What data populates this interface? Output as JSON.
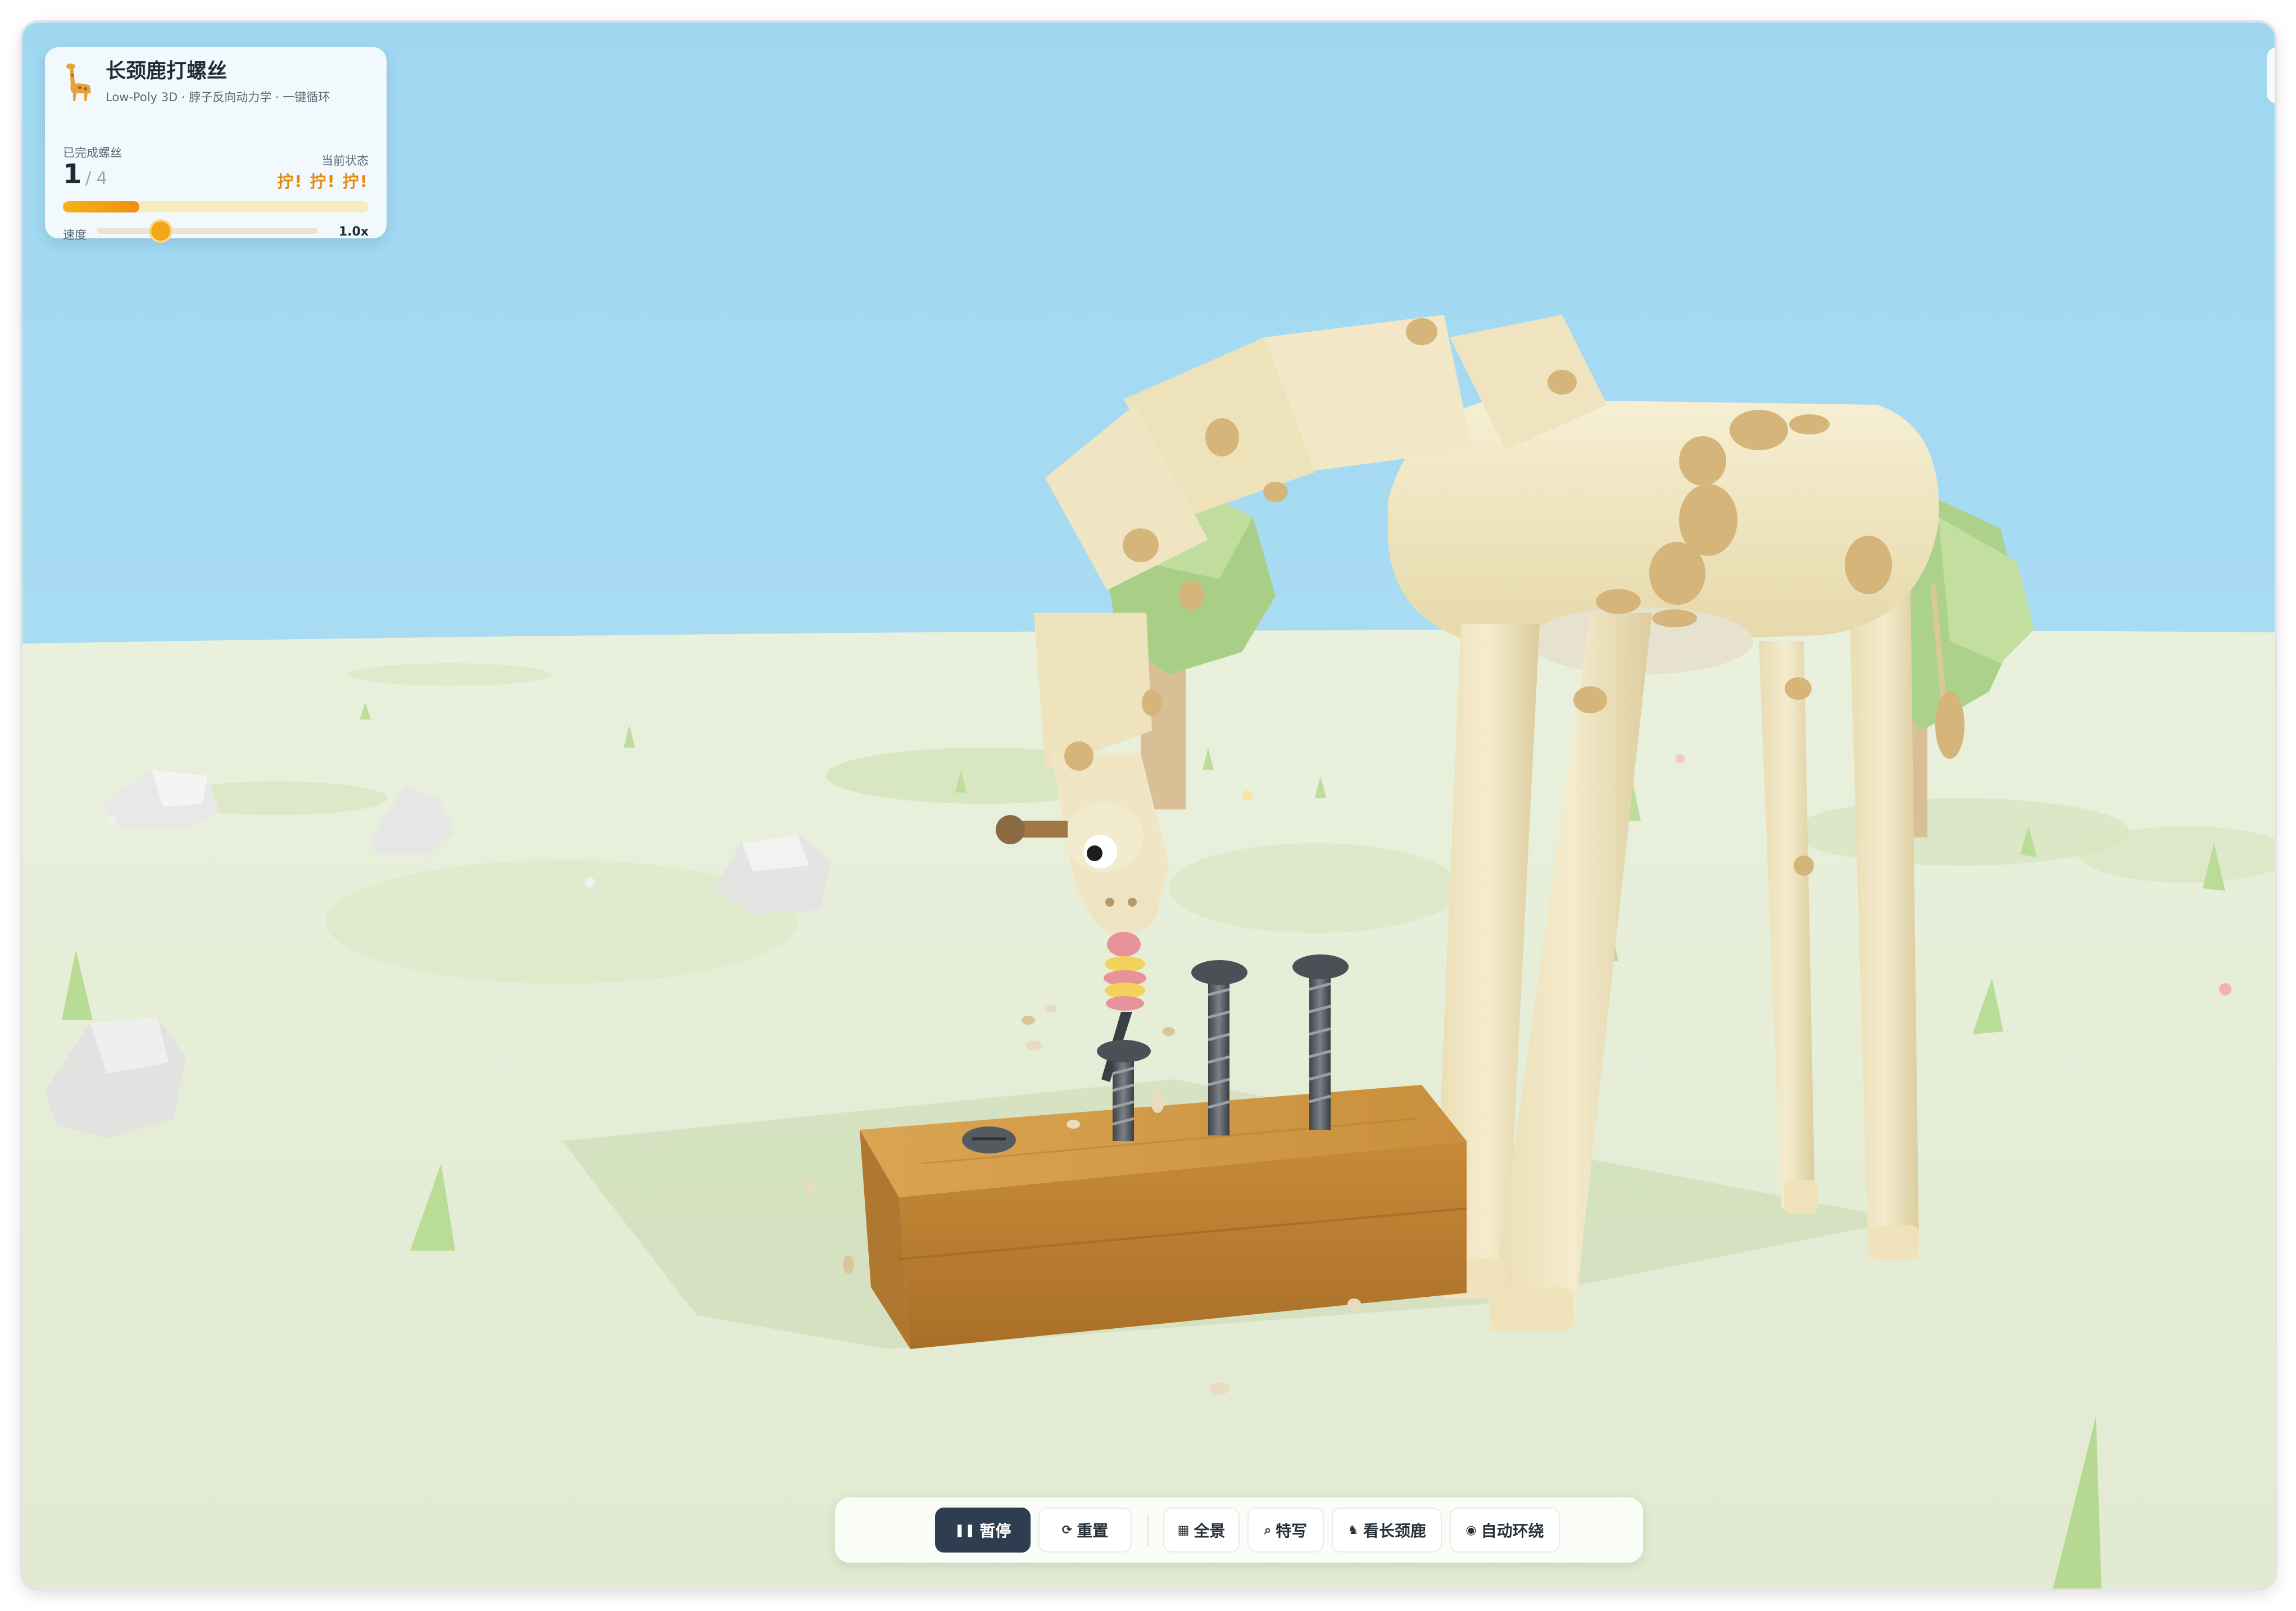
{
  "hud": {
    "title": "长颈鹿打螺丝",
    "subtitle": "Low-Poly 3D · 脖子反向动力学 · 一键循环",
    "completed_label": "已完成螺丝",
    "completed_count": "1",
    "completed_total": "/ 4",
    "progress_fraction": 0.25,
    "state_label": "当前状态",
    "state_value": "拧! 拧! 拧!",
    "speed_label": "速度",
    "speed_value": "1.0x",
    "speed_slider_fraction": 0.29
  },
  "toolbar": {
    "pause_label": "暂停",
    "reset_label": "重置",
    "overview_label": "全景",
    "closeup_label": "特写",
    "watch_giraffe_label": "看长颈鹿",
    "auto_orbit_label": "自动环绕"
  },
  "colors": {
    "sky": "#a3d9f2",
    "ground": "#e5ecd6",
    "accent": "#f4a616",
    "primary_button": "#2e3e50",
    "giraffe_body": "#f0e6c3",
    "giraffe_spot": "#d5b57a",
    "wood": "#c98f3c"
  },
  "icons": {
    "logo": "giraffe-icon",
    "pause": "pause-icon",
    "reset": "reset-icon",
    "overview": "landscape-icon",
    "closeup": "magnifier-icon",
    "watch_giraffe": "giraffe-icon",
    "auto_orbit": "camera-icon"
  }
}
